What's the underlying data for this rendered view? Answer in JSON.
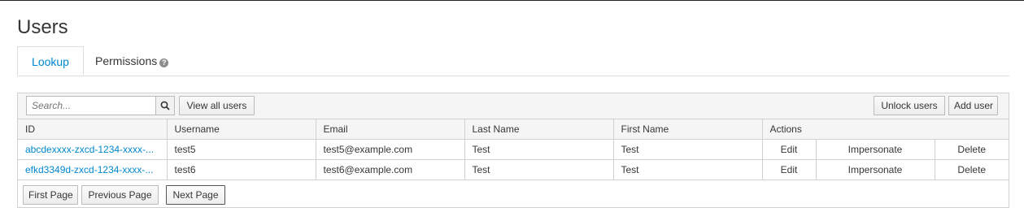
{
  "page": {
    "title": "Users"
  },
  "tabs": [
    {
      "label": "Lookup",
      "active": true
    },
    {
      "label": "Permissions",
      "icon": "help-icon",
      "active": false
    }
  ],
  "toolbar": {
    "search_placeholder": "Search...",
    "search_icon": "search-icon",
    "view_all_label": "View all users",
    "unlock_label": "Unlock users",
    "add_label": "Add user"
  },
  "table": {
    "columns": [
      "ID",
      "Username",
      "Email",
      "Last Name",
      "First Name",
      "Actions"
    ],
    "rows": [
      {
        "id": "abcdexxxx-zxcd-1234-xxxx-...",
        "username": "test5",
        "email": "test5@example.com",
        "last_name": "Test",
        "first_name": "Test",
        "actions": [
          "Edit",
          "Impersonate",
          "Delete"
        ]
      },
      {
        "id": "efkd3349d-zxcd-1234-xxxx-...",
        "username": "test6",
        "email": "test6@example.com",
        "last_name": "Test",
        "first_name": "Test",
        "actions": [
          "Edit",
          "Impersonate",
          "Delete"
        ]
      }
    ]
  },
  "pager": {
    "first": "First Page",
    "previous": "Previous Page",
    "next": "Next Page"
  },
  "colors": {
    "link": "#0088ce",
    "border": "#d1d1d1",
    "header_bg": "#f5f5f5"
  }
}
